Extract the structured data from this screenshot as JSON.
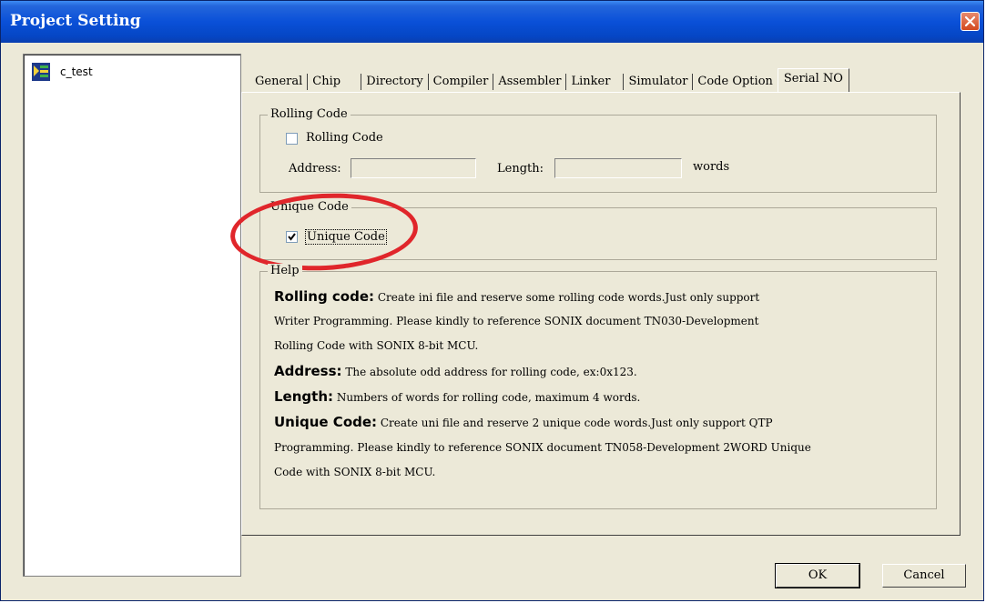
{
  "window": {
    "title": "Project Setting"
  },
  "tree": {
    "item": "c_test"
  },
  "tabs": [
    {
      "label": "General"
    },
    {
      "label": "Chip"
    },
    {
      "label": "Directory"
    },
    {
      "label": "Compiler"
    },
    {
      "label": "Assembler"
    },
    {
      "label": "Linker"
    },
    {
      "label": "Simulator"
    },
    {
      "label": "Code Option"
    },
    {
      "label": "Serial NO"
    }
  ],
  "rolling_group": {
    "label": "Rolling Code",
    "checkbox_label": "Rolling Code",
    "checked": false,
    "address_label": "Address:",
    "address_value": "",
    "length_label": "Length:",
    "length_value": "",
    "unit": "words"
  },
  "unique_group": {
    "label": "Unique Code",
    "checkbox_label": "Unique Code",
    "checked": true
  },
  "help": {
    "label": "Help",
    "lines": [
      {
        "key": "Rolling code:",
        "text": "Create ini file and reserve some rolling code words.Just only support"
      },
      {
        "key": "",
        "text": "Writer Programming. Please kindly to reference SONIX document TN030-Development"
      },
      {
        "key": "",
        "text": "Rolling Code with SONIX 8-bit MCU."
      },
      {
        "key": "Address:",
        "text": "The absolute odd address for rolling code, ex:0x123."
      },
      {
        "key": "Length:",
        "text": "Numbers of words for rolling code, maximum 4 words."
      },
      {
        "key": "Unique Code:",
        "text": "Create uni file and reserve 2 unique code words.Just only support QTP"
      },
      {
        "key": "",
        "text": "Programming. Please kindly to reference SONIX document TN058-Development 2WORD Unique"
      },
      {
        "key": "",
        "text": "Code with SONIX 8-bit MCU."
      }
    ]
  },
  "buttons": {
    "ok": "OK",
    "cancel": "Cancel"
  },
  "colors": {
    "titlebar": "#0a50d8",
    "annotation": "#e0262b",
    "dialog_bg": "#ece9d8"
  }
}
